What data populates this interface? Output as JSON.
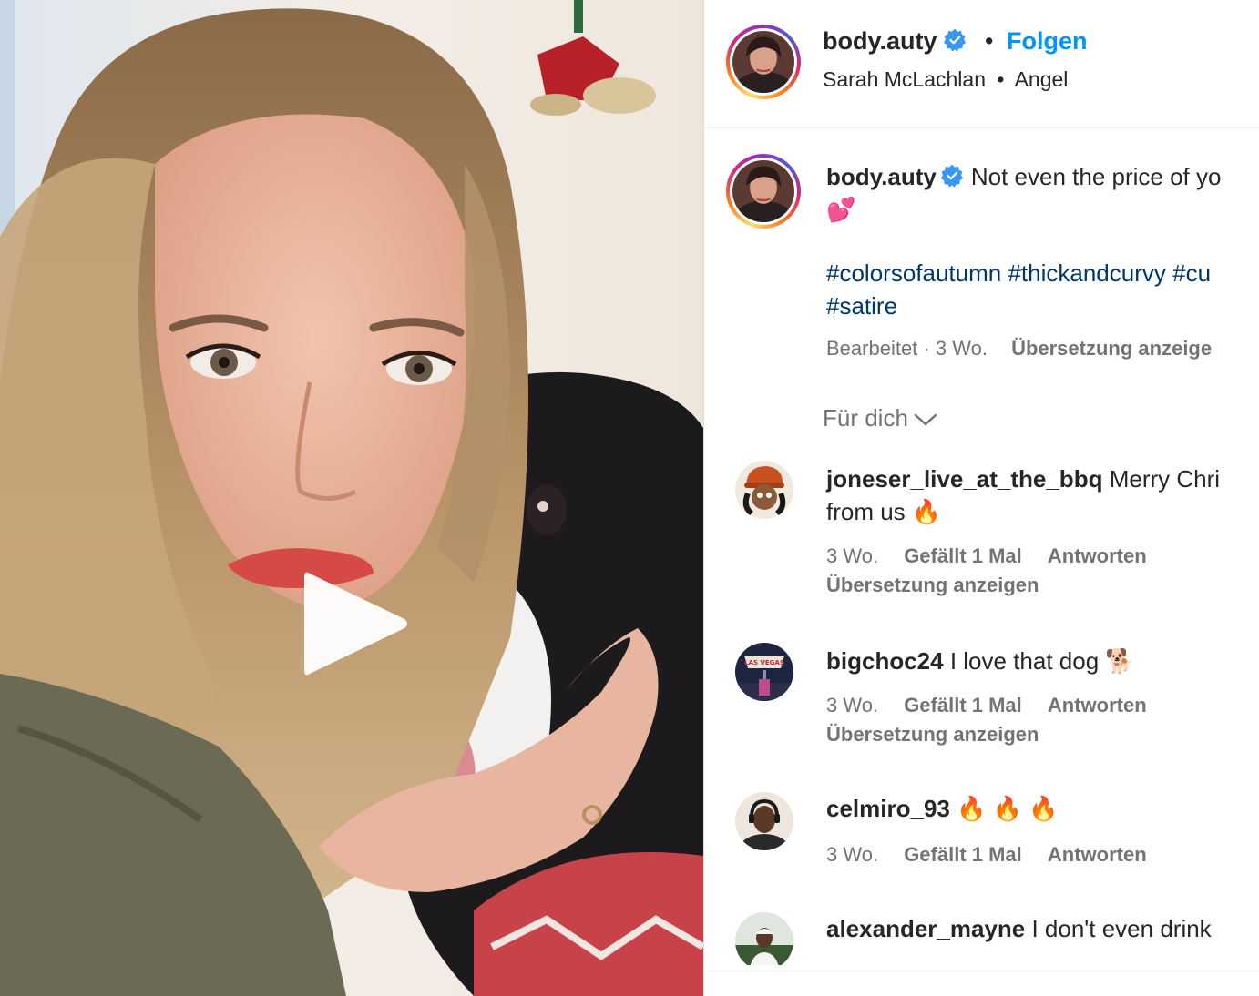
{
  "header": {
    "username": "body.auty",
    "separator": "•",
    "follow_label": "Folgen",
    "audio_artist": "Sarah McLachlan",
    "audio_separator": "•",
    "audio_track": "Angel"
  },
  "caption": {
    "username": "body.auty",
    "text": "Not even the price of yo",
    "emoji": "💕",
    "hashtags": [
      "#colorsofautumn",
      "#thickandcurvy",
      "#cu",
      "#satire"
    ],
    "edited_label": "Bearbeitet",
    "time_separator": "·",
    "time": "3 Wo.",
    "translate_label": "Übersetzung anzeige"
  },
  "sort": {
    "label": "Für dich"
  },
  "comments": [
    {
      "username": "joneser_live_at_the_bbq",
      "text_line1": "Merry Chri",
      "text_line2": "from us 🔥",
      "time": "3 Wo.",
      "likes": "Gefällt 1 Mal",
      "reply_label": "Antworten",
      "translate_label": "Übersetzung anzeigen"
    },
    {
      "username": "bigchoc24",
      "text_line1": "I love that dog 🐕",
      "time": "3 Wo.",
      "likes": "Gefällt 1 Mal",
      "reply_label": "Antworten",
      "translate_label": "Übersetzung anzeigen",
      "avatar_text": "LAS VEGAS"
    },
    {
      "username": "celmiro_93",
      "text_line1": "🔥 🔥 🔥",
      "time": "3 Wo.",
      "likes": "Gefällt 1 Mal",
      "reply_label": "Antworten"
    },
    {
      "username": "alexander_mayne",
      "text_line1": "I don't even drink"
    }
  ],
  "colors": {
    "link_blue": "#0095f6",
    "hashtag_blue": "#00376b",
    "muted_gray": "#737373",
    "verified_blue": "#3897f0"
  },
  "icons": {
    "play": "play-icon",
    "verified": "verified-badge-icon",
    "chevron": "chevron-down-icon"
  }
}
